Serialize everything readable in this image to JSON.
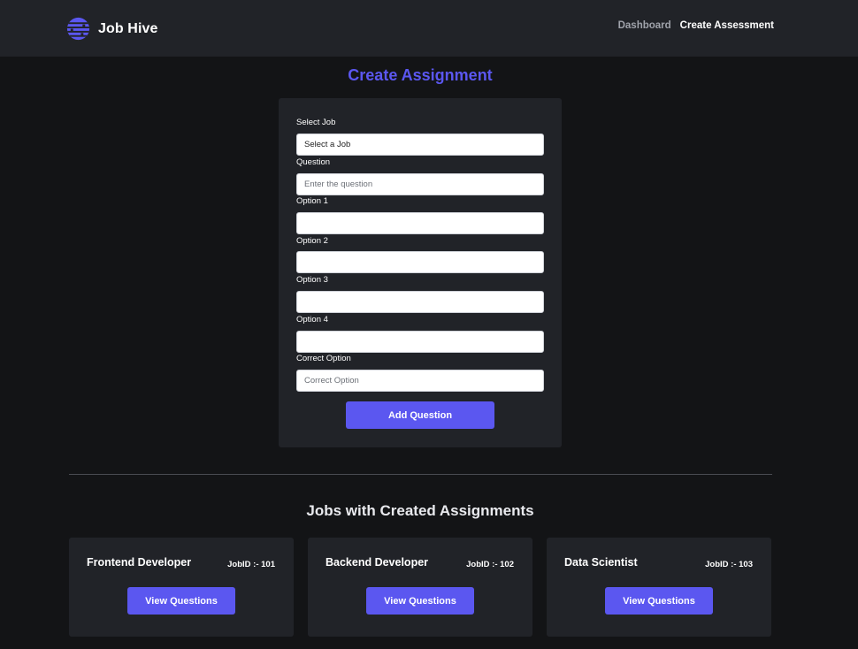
{
  "brand": {
    "name": "Job Hive",
    "logo_icon": "hive-globe-icon"
  },
  "nav": {
    "items": [
      {
        "label": "Dashboard",
        "active": false
      },
      {
        "label": "Create Assessment",
        "active": true
      }
    ]
  },
  "form": {
    "title": "Create Assignment",
    "select_job": {
      "label": "Select Job",
      "value": "Select a Job"
    },
    "question": {
      "label": "Question",
      "value": "",
      "placeholder": "Enter the question"
    },
    "option1": {
      "label": "Option 1",
      "value": ""
    },
    "option2": {
      "label": "Option 2",
      "value": ""
    },
    "option3": {
      "label": "Option 3",
      "value": ""
    },
    "option4": {
      "label": "Option 4",
      "value": ""
    },
    "correct_option": {
      "label": "Correct Option",
      "value": "",
      "placeholder": "Correct Option"
    },
    "submit_label": "Add Question"
  },
  "jobs_section": {
    "title": "Jobs with Created Assignments",
    "jobs": [
      {
        "title": "Frontend Developer",
        "job_id": "JobID :- 101",
        "button_label": "View Questions"
      },
      {
        "title": "Backend Developer",
        "job_id": "JobID :- 102",
        "button_label": "View Questions"
      },
      {
        "title": "Data Scientist",
        "job_id": "JobID :- 103",
        "button_label": "View Questions"
      }
    ]
  },
  "colors": {
    "accent": "#5b57f0",
    "navbar_bg": "#212328",
    "page_bg": "#131416",
    "card_bg": "#212328"
  }
}
